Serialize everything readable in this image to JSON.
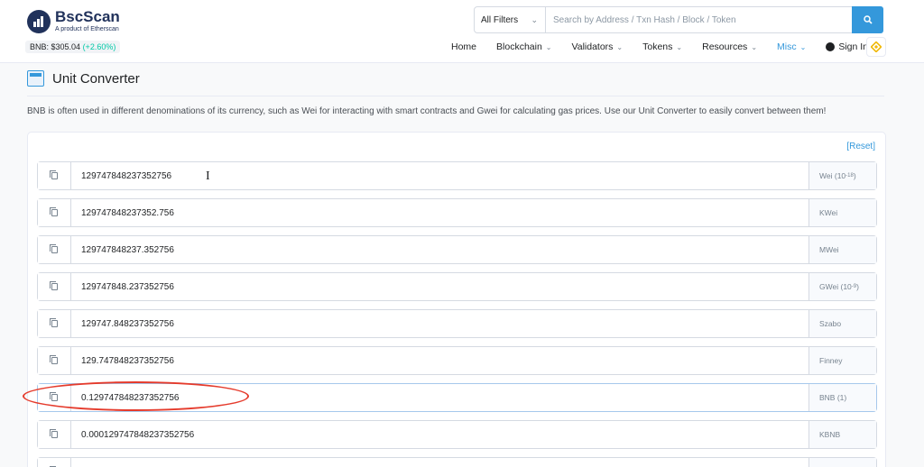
{
  "brand": {
    "name": "BscScan",
    "tagline": "A product of Etherscan"
  },
  "price": {
    "label": "BNB: $305.04",
    "change": "(+2.60%)"
  },
  "search": {
    "filter": "All Filters",
    "placeholder": "Search by Address / Txn Hash / Block / Token"
  },
  "nav": [
    {
      "label": "Home",
      "caret": false
    },
    {
      "label": "Blockchain",
      "caret": true
    },
    {
      "label": "Validators",
      "caret": true
    },
    {
      "label": "Tokens",
      "caret": true
    },
    {
      "label": "Resources",
      "caret": true
    },
    {
      "label": "Misc",
      "caret": true,
      "active": true
    }
  ],
  "signin": "Sign In",
  "page": {
    "title": "Unit Converter",
    "description": "BNB is often used in different denominations of its currency, such as Wei for interacting with smart contracts and Gwei for calculating gas prices. Use our Unit Converter to easily convert between them!",
    "reset": "[Reset]"
  },
  "rows": [
    {
      "value": "129747848237352756",
      "unit": "Wei",
      "exp": "(10",
      "sup": "-18",
      "close": ")"
    },
    {
      "value": "129747848237352.756",
      "unit": "KWei"
    },
    {
      "value": "129747848237.352756",
      "unit": "MWei"
    },
    {
      "value": "129747848.237352756",
      "unit": "GWei",
      "exp": "(10",
      "sup": "-9",
      "close": ")"
    },
    {
      "value": "129747.848237352756",
      "unit": "Szabo"
    },
    {
      "value": "129.747848237352756",
      "unit": "Finney"
    },
    {
      "value": "0.129747848237352756",
      "unit": "BNB (1)"
    },
    {
      "value": "0.000129747848237352756",
      "unit": "KBNB"
    }
  ],
  "colors": {
    "accent": "#3498db",
    "highlight": "#e53b2c",
    "positive": "#00c9a7"
  }
}
